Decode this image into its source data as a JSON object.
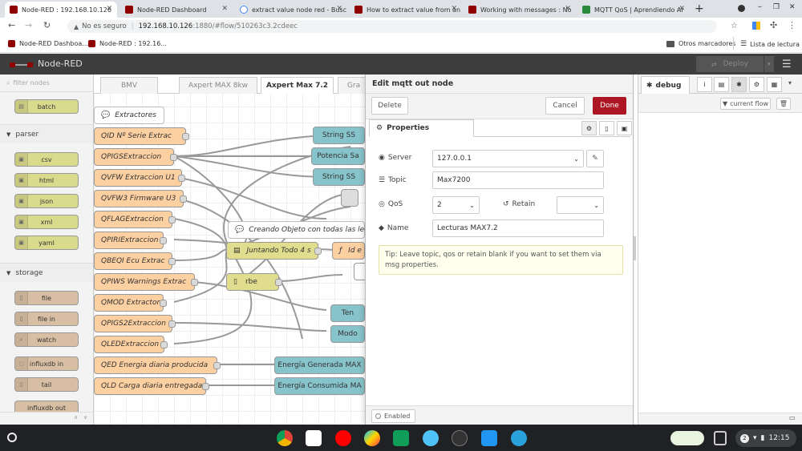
{
  "browser": {
    "tabs": [
      {
        "title": "Node-RED : 192.168.10.126",
        "active": true
      },
      {
        "title": "Node-RED Dashboard"
      },
      {
        "title": "extract value node red - Busc"
      },
      {
        "title": "How to extract value from an"
      },
      {
        "title": "Working with messages : No"
      },
      {
        "title": "MQTT QoS | Aprendiendo Ar"
      }
    ],
    "security": "No es seguro",
    "url_host": "192.168.10.126",
    "url_path": ":1880/#flow/510263c3.2cdeec",
    "bookmarks": [
      "Node-RED Dashboa...",
      "Node-RED : 192.16..."
    ],
    "other_bookmarks": "Otros marcadores",
    "reading_list": "Lista de lectura"
  },
  "nodered": {
    "title": "Node-RED",
    "deploy": "Deploy",
    "palette": {
      "filter_placeholder": "filter nodes",
      "top_node": "batch",
      "categories": [
        {
          "name": "parser",
          "nodes": [
            "csv",
            "html",
            "json",
            "xml",
            "yaml"
          ]
        },
        {
          "name": "storage",
          "nodes": [
            "file",
            "file in",
            "watch",
            "influxdb in",
            "tail",
            "influxdb out"
          ]
        }
      ]
    },
    "workspace_tabs": [
      "BMV",
      "Axpert MAX 8kw",
      "Axpert Max 7.2",
      "Gra"
    ],
    "flow_nodes": {
      "extractores": "Extractores",
      "n1": "QID Nº Serie Extrac",
      "n2": "QPIGSExtraccion",
      "n3": "QVFW Extraccion U1",
      "n4": "QVFW3 Firmware U3",
      "n5": "QFLAGExtraccion",
      "n6": "QPIRIExtraccion",
      "n7": "QBEQI Ecu Extrac",
      "n8": "QPIWS Warnings Extrac",
      "n9": "QMOD Extractor",
      "n10": "QPIGS2Extraccion",
      "n11": "QLEDExtraccion",
      "n12": "QED Energia diaria producida",
      "n13": "QLD Carga diaria entregada",
      "string1": "String SS",
      "potencia": "Potencia Sa",
      "string2": "String SS",
      "comment2": "Creando Objeto con todas las lectur",
      "juntando": "Juntando Todo 4 s",
      "ide": "Id e",
      "rbe": "rbe",
      "ten": "Ten",
      "modo": "Modo",
      "energia_gen": "Energía Generada MAX",
      "energia_con": "Energía Consumida MA"
    },
    "editor": {
      "title": "Edit mqtt out node",
      "delete": "Delete",
      "cancel": "Cancel",
      "done": "Done",
      "tab_properties": "Properties",
      "server_label": "Server",
      "server_value": "127.0.0.1",
      "topic_label": "Topic",
      "topic_value": "Max7200",
      "qos_label": "QoS",
      "qos_value": "2",
      "retain_label": "Retain",
      "retain_value": "",
      "name_label": "Name",
      "name_value": "Lecturas MAX7.2",
      "tip": "Tip: Leave topic, qos or retain blank if you want to set them via msg properties.",
      "enabled": "Enabled"
    },
    "sidebar": {
      "tab": "debug",
      "filter": "current flow"
    }
  },
  "taskbar": {
    "time": "12:15",
    "notifications": "2"
  }
}
